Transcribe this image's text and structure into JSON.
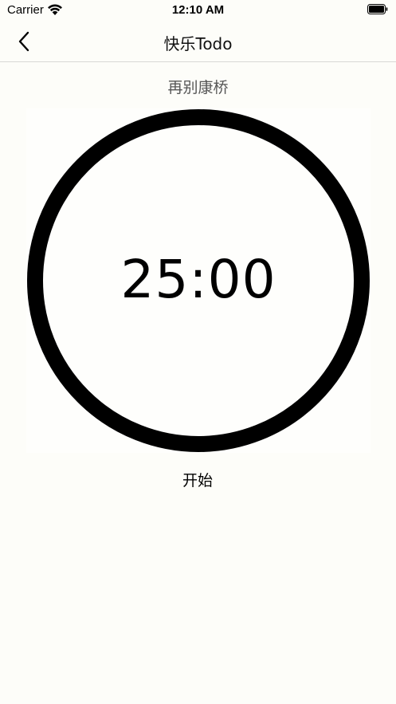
{
  "status_bar": {
    "carrier": "Carrier",
    "time": "12:10 AM"
  },
  "nav": {
    "title": "快乐Todo",
    "back_icon": "chevron-left-icon"
  },
  "task": {
    "title": "再别康桥"
  },
  "timer": {
    "remaining": "25:00",
    "ring_color": "#000000"
  },
  "controls": {
    "start_label": "开始"
  }
}
